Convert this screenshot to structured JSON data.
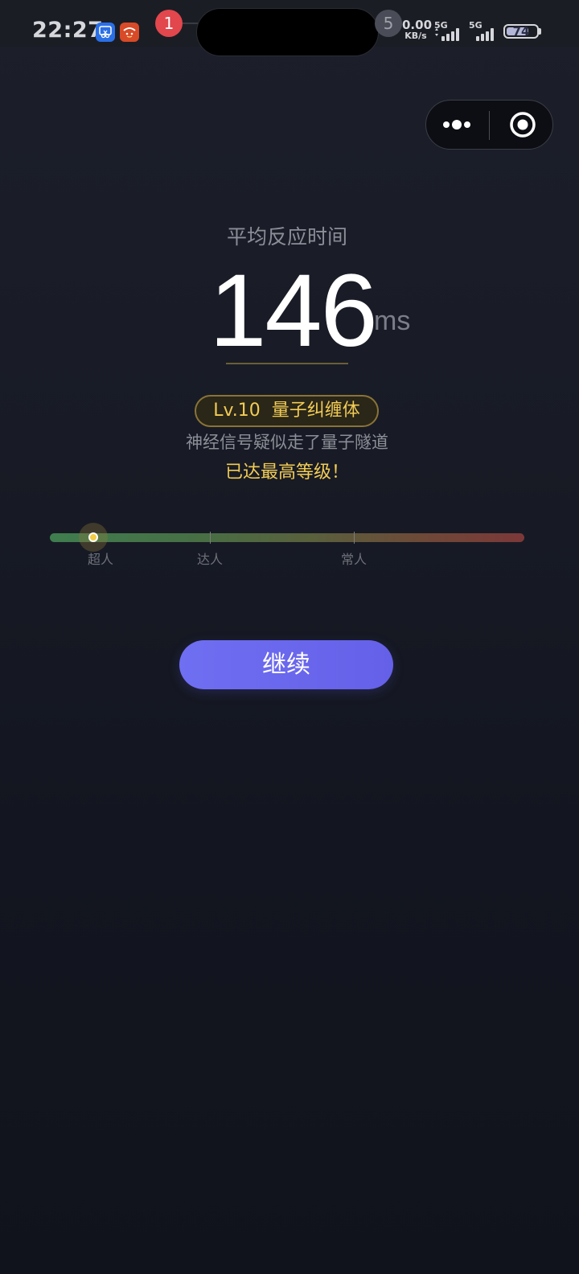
{
  "status_bar": {
    "time": "22:27",
    "notification_count_left": "1",
    "notification_count_right": "5",
    "net_speed_value": "0.00",
    "net_speed_unit": "KB/s",
    "signal1_label": "5G",
    "signal2_label": "5G",
    "battery_level": "74",
    "battery_percent": 74
  },
  "capsule": {
    "more_icon": "more-dots-icon",
    "close_icon": "target-circle-icon"
  },
  "result": {
    "label": "平均反应时间",
    "value": "146",
    "unit": "ms",
    "level_badge": "Lv.10  量子纠缠体",
    "description": "神经信号疑似走了量子隧道",
    "max_level_text": "已达最高等级！"
  },
  "scale": {
    "labels": [
      "超人",
      "达人",
      "常人"
    ]
  },
  "actions": {
    "continue_label": "继续"
  },
  "colors": {
    "accent_gold": "#f2cc55",
    "button_purple": "#6a68ee",
    "background": "#151822"
  }
}
